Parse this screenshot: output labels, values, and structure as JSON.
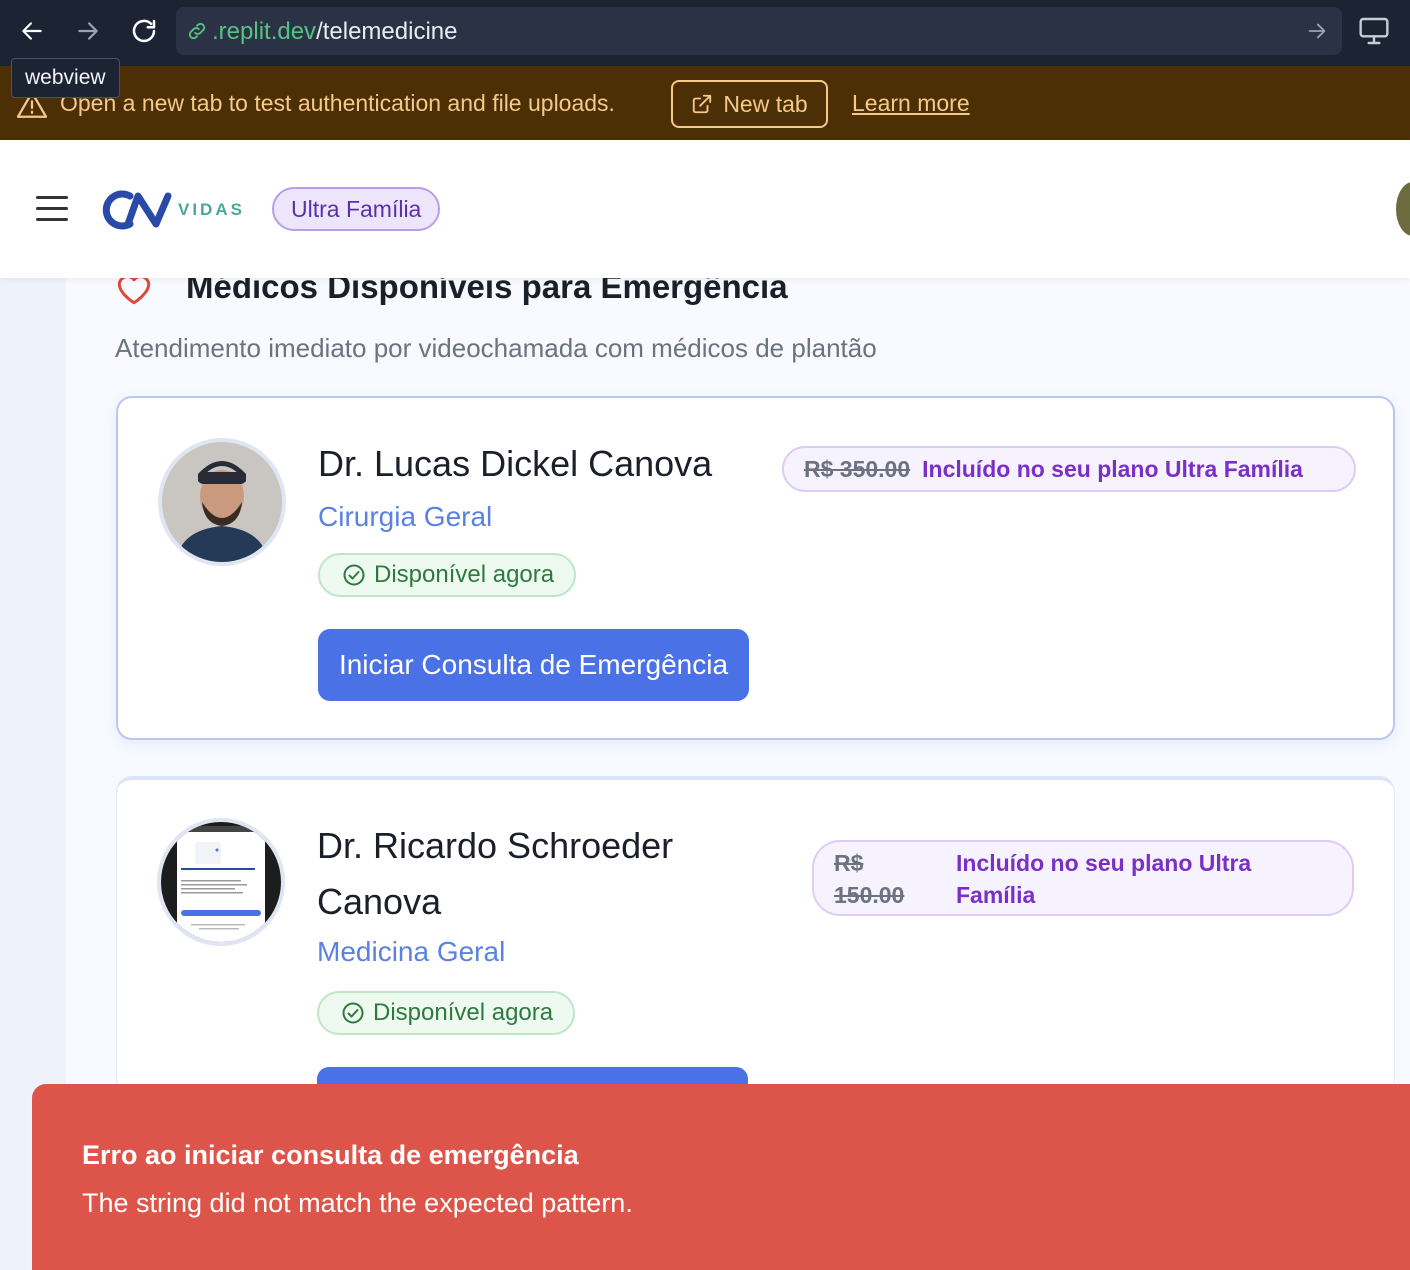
{
  "browser": {
    "url_domain": ".replit.dev",
    "url_path": "/telemedicine",
    "tooltip": "webview"
  },
  "banner": {
    "message": "Open a new tab to test authentication and file uploads.",
    "new_tab_label": "New tab",
    "learn_more_label": "Learn more"
  },
  "header": {
    "logo_sub": "VIDAS",
    "plan_badge": "Ultra Família"
  },
  "section": {
    "title": "Médicos Disponíveis para Emergência",
    "subtitle": "Atendimento imediato por videochamada com médicos de plantão"
  },
  "doctors": [
    {
      "name": "Dr. Lucas Dickel Canova",
      "specialty": "Cirurgia Geral",
      "status": "Disponível agora",
      "old_price": "R$ 350.00",
      "included": "Incluído no seu plano Ultra Família",
      "cta": "Iniciar Consulta de Emergência"
    },
    {
      "name_line1": "Dr. Ricardo Schroeder",
      "name_line2": "Canova",
      "specialty": "Medicina Geral",
      "status": "Disponível agora",
      "old_price_line1": "R$",
      "old_price_line2": "150.00",
      "included_line1": "Incluído no seu plano Ultra",
      "included_line2": "Família"
    }
  ],
  "toast": {
    "title": "Erro ao iniciar consulta de emergência",
    "message": "The string did not match the expected pattern."
  },
  "colors": {
    "primary": "#4a72e6",
    "toast_error": "#dd554a",
    "available_green": "#2d7a3f",
    "plan_purple": "#7a2fc6"
  },
  "icons": [
    "back-arrow-icon",
    "forward-arrow-icon",
    "reload-icon",
    "link-icon",
    "go-arrow-icon",
    "device-preview-icon",
    "warning-icon",
    "external-link-icon",
    "menu-icon",
    "heart-icon",
    "check-circle-icon"
  ]
}
